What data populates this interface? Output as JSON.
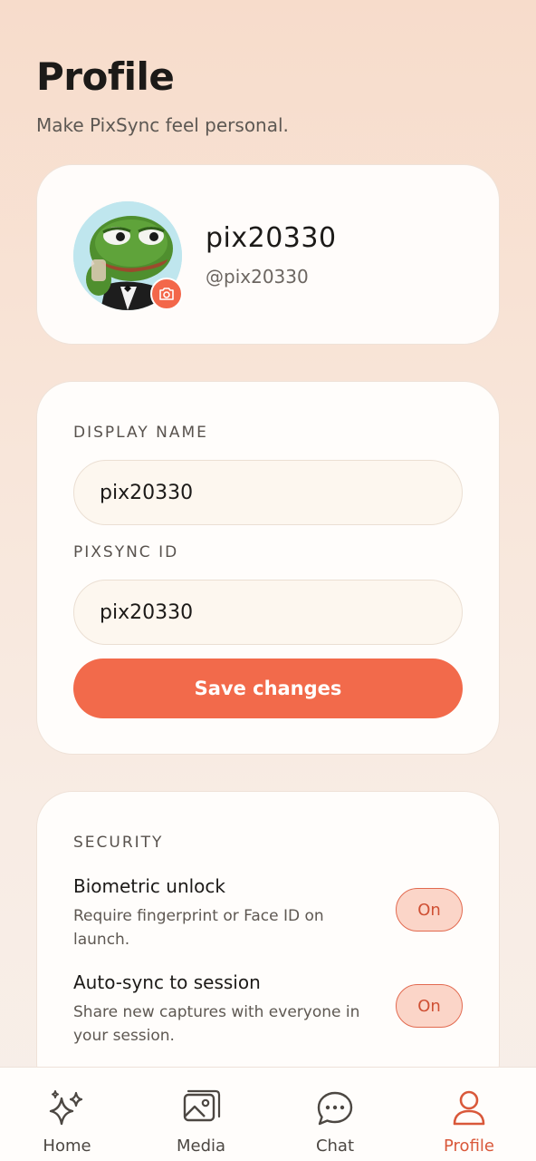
{
  "header": {
    "title": "Profile",
    "subtitle": "Make PixSync feel personal."
  },
  "profile": {
    "display_name": "pix20330",
    "handle": "@pix20330",
    "avatar_icon": "frog-avatar",
    "camera_icon": "camera-icon"
  },
  "form": {
    "display_name_label": "DISPLAY NAME",
    "display_name_value": "pix20330",
    "pixsync_id_label": "PIXSYNC ID",
    "pixsync_id_value": "pix20330",
    "save_label": "Save changes"
  },
  "security": {
    "section_label": "SECURITY",
    "settings": [
      {
        "title": "Biometric unlock",
        "description": "Require fingerprint or Face ID on launch.",
        "state": "On"
      },
      {
        "title": "Auto-sync to session",
        "description": "Share new captures with everyone in your session.",
        "state": "On"
      }
    ]
  },
  "tabs": [
    {
      "label": "Home",
      "icon": "sparkles-icon"
    },
    {
      "label": "Media",
      "icon": "gallery-icon"
    },
    {
      "label": "Chat",
      "icon": "chat-bubble-icon"
    },
    {
      "label": "Profile",
      "icon": "person-icon",
      "active": true
    }
  ],
  "colors": {
    "accent": "#f26a4b",
    "active_tab": "#d9583a",
    "toggle_bg": "#fbd5c8"
  }
}
